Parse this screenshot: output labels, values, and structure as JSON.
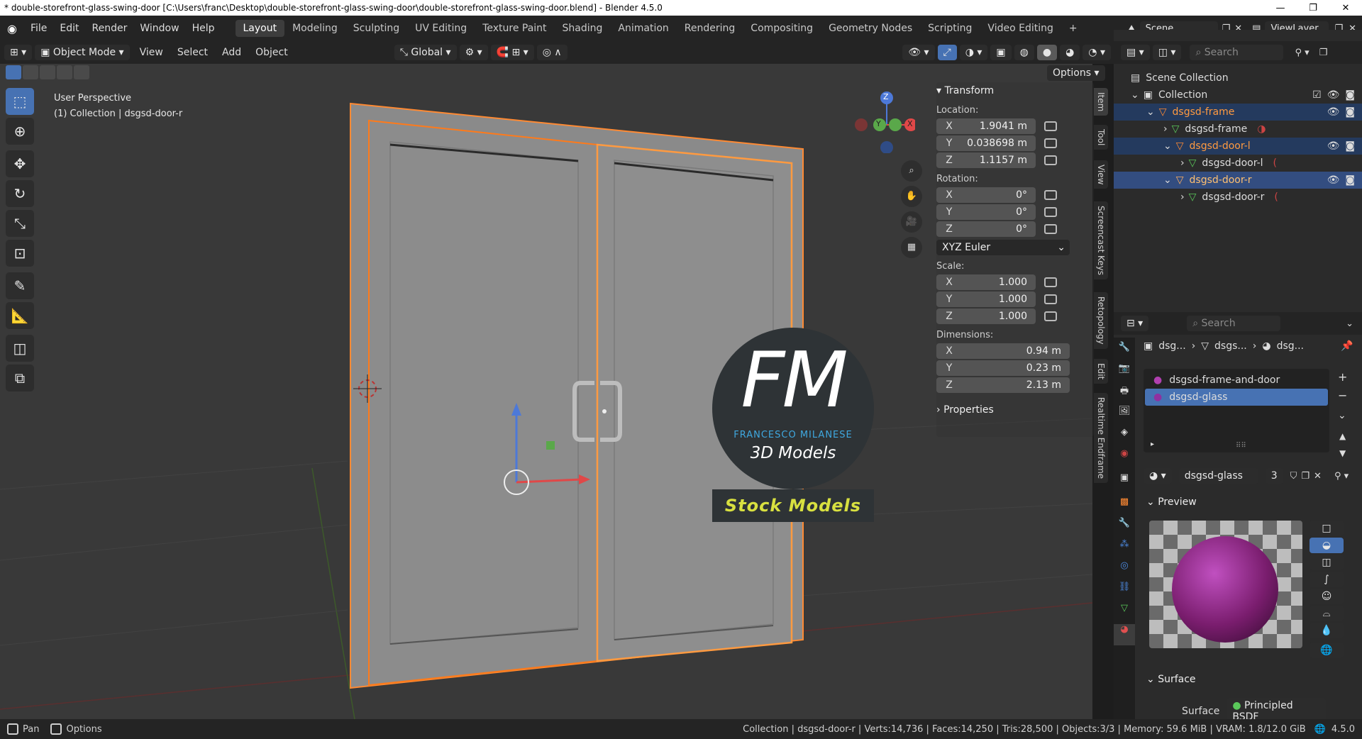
{
  "titlebar": {
    "title": "* double-storefront-glass-swing-door [C:\\Users\\franc\\Desktop\\double-storefront-glass-swing-door\\double-storefront-glass-swing-door.blend] - Blender 4.5.0",
    "minimize": "—",
    "maximize": "❐",
    "close": "✕"
  },
  "menus": [
    "File",
    "Edit",
    "Render",
    "Window",
    "Help"
  ],
  "workspaces": [
    "Layout",
    "Modeling",
    "Sculpting",
    "UV Editing",
    "Texture Paint",
    "Shading",
    "Animation",
    "Rendering",
    "Compositing",
    "Geometry Nodes",
    "Scripting",
    "Video Editing"
  ],
  "active_workspace": "Layout",
  "add_workspace": "+",
  "scene": "Scene",
  "view_layer": "ViewLayer",
  "viewport_header": {
    "mode": "Object Mode",
    "menus": [
      "View",
      "Select",
      "Add",
      "Object"
    ],
    "orientation": "Global",
    "options": "Options"
  },
  "viewport": {
    "perspective": "User Perspective",
    "collection_info": "(1) Collection | dsgsd-door-r",
    "gizmo_axes": {
      "z": "Z",
      "y": "Y",
      "x": "X"
    },
    "watermark": {
      "logo_letters": "FM",
      "brand": "FRANCESCO MILANESE",
      "subtitle": "3D Models",
      "banner": "Stock Models"
    }
  },
  "tools": [
    "select-box",
    "cursor",
    "move",
    "rotate",
    "scale",
    "transform",
    "annotate",
    "measure",
    "add-cube",
    "extrude"
  ],
  "npanel": {
    "section": "Transform",
    "location_label": "Location:",
    "location": [
      {
        "axis": "X",
        "value": "1.9041 m"
      },
      {
        "axis": "Y",
        "value": "0.038698 m"
      },
      {
        "axis": "Z",
        "value": "1.1157 m"
      }
    ],
    "rotation_label": "Rotation:",
    "rotation": [
      {
        "axis": "X",
        "value": "0°"
      },
      {
        "axis": "Y",
        "value": "0°"
      },
      {
        "axis": "Z",
        "value": "0°"
      }
    ],
    "rotation_mode": "XYZ Euler",
    "scale_label": "Scale:",
    "scale": [
      {
        "axis": "X",
        "value": "1.000"
      },
      {
        "axis": "Y",
        "value": "1.000"
      },
      {
        "axis": "Z",
        "value": "1.000"
      }
    ],
    "dimensions_label": "Dimensions:",
    "dimensions": [
      {
        "axis": "X",
        "value": "0.94 m"
      },
      {
        "axis": "Y",
        "value": "0.23 m"
      },
      {
        "axis": "Z",
        "value": "2.13 m"
      }
    ],
    "properties": "Properties",
    "tabs": [
      "Item",
      "Tool",
      "View",
      "Screencast Keys",
      "Retopology",
      "Edit",
      "Realtime Endframe"
    ]
  },
  "outliner": {
    "search_placeholder": "Search",
    "scene_collection": "Scene Collection",
    "collection": "Collection",
    "items": [
      {
        "name": "dsgsd-frame",
        "kind": "object",
        "level": 1
      },
      {
        "name": "dsgsd-frame",
        "kind": "mesh",
        "level": 2
      },
      {
        "name": "dsgsd-door-l",
        "kind": "object",
        "level": 1
      },
      {
        "name": "dsgsd-door-l",
        "kind": "mesh",
        "level": 2
      },
      {
        "name": "dsgsd-door-r",
        "kind": "object",
        "level": 1
      },
      {
        "name": "dsgsd-door-r",
        "kind": "mesh",
        "level": 2
      }
    ]
  },
  "properties": {
    "search_placeholder": "Search",
    "breadcrumb": [
      "dsg...",
      "dsgs...",
      "dsg..."
    ],
    "materials": [
      "dsgsd-frame-and-door",
      "dsgsd-glass"
    ],
    "selected_material": "dsgsd-glass",
    "material_name": "dsgsd-glass",
    "user_count": "3",
    "preview_label": "Preview",
    "surface_section": "Surface",
    "surface_label": "Surface",
    "surface_value": "Principled BSDF",
    "colors": {
      "preview_sphere": "#7a1d6e",
      "accent": "#4772b3",
      "selection_orange": "#ff8a33"
    }
  },
  "statusbar": {
    "pan": "Pan",
    "options": "Options",
    "stats": "Collection | dsgsd-door-r | Verts:14,736 | Faces:14,250 | Tris:28,500 | Objects:3/3 | Memory: 59.6 MiB | VRAM: 1.8/12.0 GiB",
    "version": "4.5.0"
  }
}
